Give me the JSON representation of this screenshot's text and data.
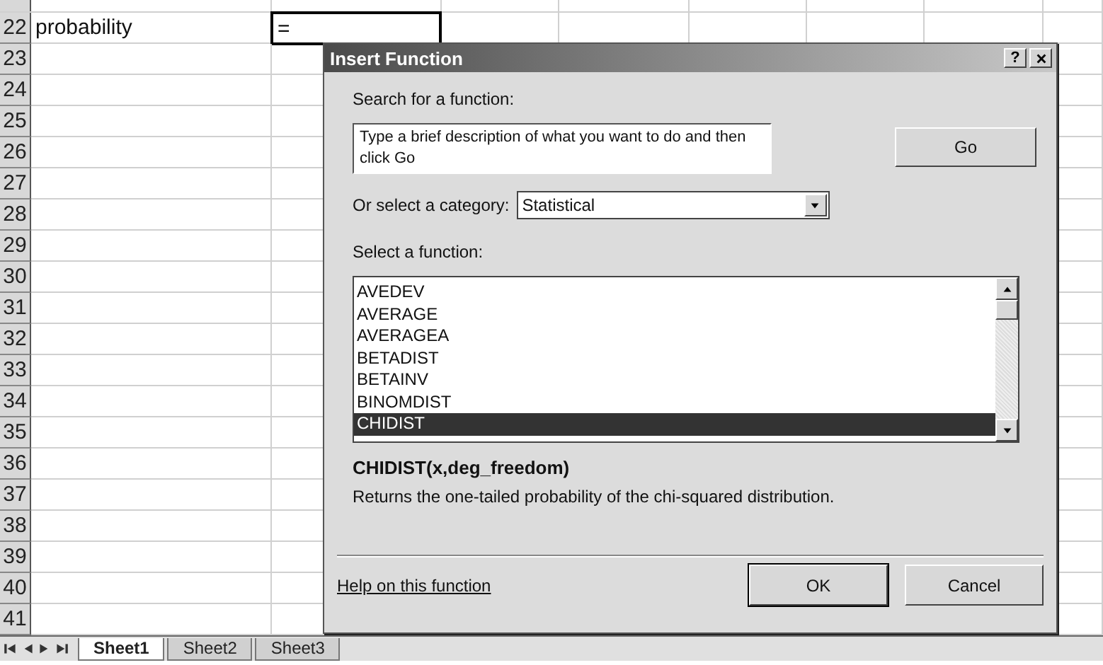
{
  "sheet": {
    "rows": [
      {
        "cells": []
      },
      {
        "label": "22",
        "cells": [
          {
            "text": "probability",
            "selected": false
          },
          {
            "text": "=",
            "selected": true
          }
        ]
      },
      {
        "label": "23",
        "cells": []
      },
      {
        "label": "24",
        "cells": []
      },
      {
        "label": "25",
        "cells": []
      },
      {
        "label": "26",
        "cells": []
      },
      {
        "label": "27",
        "cells": []
      },
      {
        "label": "28",
        "cells": []
      },
      {
        "label": "29",
        "cells": []
      },
      {
        "label": "30",
        "cells": []
      },
      {
        "label": "31",
        "cells": []
      },
      {
        "label": "32",
        "cells": []
      },
      {
        "label": "33",
        "cells": []
      },
      {
        "label": "34",
        "cells": []
      },
      {
        "label": "35",
        "cells": []
      },
      {
        "label": "36",
        "cells": []
      },
      {
        "label": "37",
        "cells": []
      },
      {
        "label": "38",
        "cells": []
      },
      {
        "label": "39",
        "cells": []
      },
      {
        "label": "40",
        "cells": []
      },
      {
        "label": "41",
        "cells": []
      }
    ],
    "tabs": [
      {
        "label": "Sheet1",
        "selected": true
      },
      {
        "label": "Sheet2",
        "selected": false
      },
      {
        "label": "Sheet3",
        "selected": false
      }
    ]
  },
  "dialog": {
    "title": "Insert Function",
    "help_button": "?",
    "search_label": "Search for a function:",
    "search_field": {
      "value": "Type a brief description of what you want to do and then click Go"
    },
    "go_button": "Go",
    "category_label": "Or select a category:",
    "category": "Statistical",
    "function_label": "Select a function:",
    "functions": [
      {
        "name": "AVEDEV",
        "selected": false
      },
      {
        "name": "AVERAGE",
        "selected": false
      },
      {
        "name": "AVERAGEA",
        "selected": false
      },
      {
        "name": "BETADIST",
        "selected": false
      },
      {
        "name": "BETAINV",
        "selected": false
      },
      {
        "name": "BINOMDIST",
        "selected": false
      },
      {
        "name": "CHIDIST",
        "selected": true
      }
    ],
    "signature": "CHIDIST(x,deg_freedom)",
    "description": "Returns the one-tailed probability of the chi-squared distribution.",
    "help_link": "Help on this function",
    "buttons": [
      "OK",
      "Cancel"
    ]
  }
}
